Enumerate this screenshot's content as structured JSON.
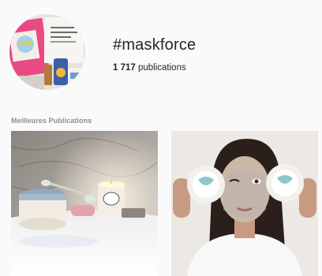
{
  "hashtag": {
    "title": "#maskforce",
    "count": "1 717",
    "count_suffix": " publications"
  },
  "top_posts": {
    "label": "Meilleures Publications",
    "posts": [
      {
        "subject": "mask-jar-and-candle-photo"
      },
      {
        "subject": "woman-with-face-mask-photo"
      }
    ]
  },
  "colors": {
    "background": "#fafafa",
    "text_primary": "#262626",
    "text_secondary": "#8e8e8e"
  }
}
